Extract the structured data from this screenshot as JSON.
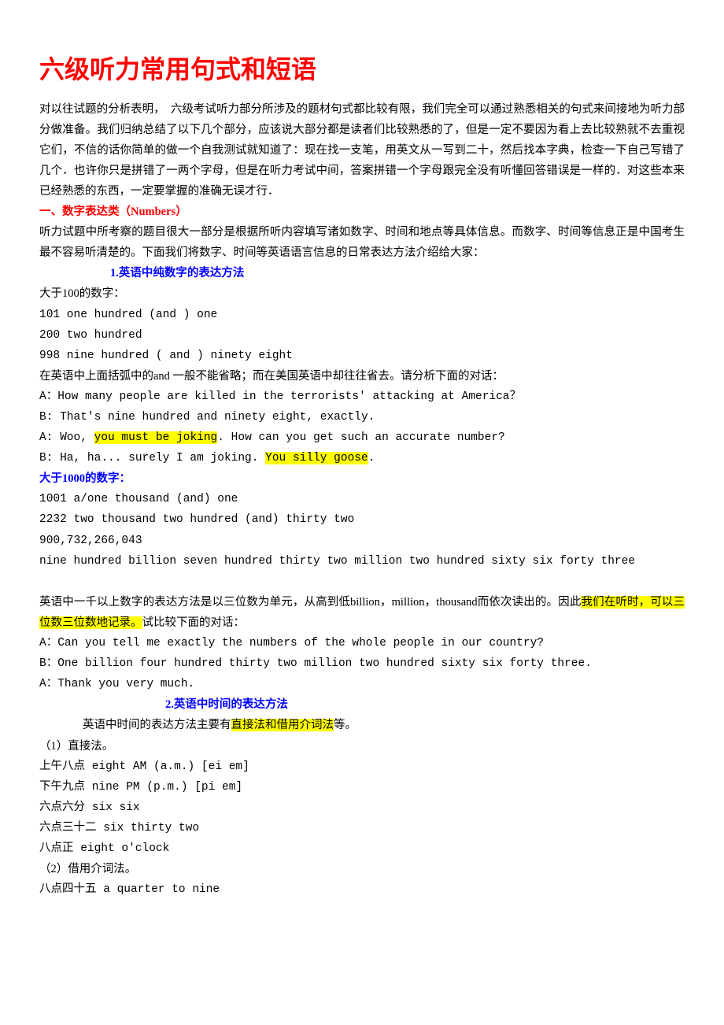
{
  "title": "六级听力常用句式和短语",
  "intro": "对以往试题的分析表明，　六级考试听力部分所涉及的题材句式都比较有限，我们完全可以通过熟悉相关的句式来间接地为听力部分做准备。我们归纳总结了以下几个部分，应该说大部分都是读者们比较熟悉的了，但是一定不要因为看上去比较熟就不去重视它们，不信的话你简单的做一个自我测试就知道了：现在找一支笔，用英文从一写到二十，然后找本字典，检查一下自己写错了几个．也许你只是拼错了一两个字母，但是在听力考试中间，答案拼错一个字母跟完全没有听懂回答错误是一样的．对这些本来已经熟悉的东西，一定要掌握的准确无误才行．",
  "sec1_heading": "一、数字表达类（Numbers）",
  "sec1_intro": "听力试题中所考察的题目很大一部分是根据所听内容填写诸如数字、时间和地点等具体信息。而数字、时间等信息正是中国考生最不容易听清楚的。下面我们将数字、时间等英语语言信息的日常表达方法介绍给大家：",
  "sub1_heading": "1.英语中纯数字的表达方法",
  "gt100_label": "大于100的数字：",
  "line_101": "101      one hundred (and ) one",
  "line_200": "200      two hundred",
  "line_998": "998      nine hundred ( and ) ninety  eight",
  "and_note": "在英语中上面括弧中的and 一般不能省略；而在美国英语中却往往省去。请分析下面的对话：",
  "dlg1_a1": "A：How many people are killed in the terrorists' attacking at America？",
  "dlg1_b1": "B:   That's nine hundred and ninety  eight, exactly.",
  "dlg1_a2_pre": "A:   Woo, ",
  "dlg1_a2_hl": "you must be joking",
  "dlg1_a2_post": ". How can you get such an accurate number?",
  "dlg1_b2_pre": "B:   Ha, ha...   surely I am joking. ",
  "dlg1_b2_hl": "You silly goose",
  "dlg1_b2_post": ".",
  "gt1000_heading": "大于1000的数字：",
  "line_1001": "1001      a/one thousand (and) one",
  "line_2232": "2232      two thousand two hundred (and) thirty  two",
  "big_num": "900,732,266,043",
  "big_num_words": "nine hundred billion seven hundred thirty  two million two hundred sixty  six forty three",
  "thousand_note_pre": "英语中一千以上数字的表达方法是以三位数为单元，从高到低billion，million，thousand而依次读出的。因此",
  "thousand_note_hl": "我们在听时，可以三位数三位数地记录。",
  "thousand_note_post": "试比较下面的对话：",
  "dlg2_a1": "A：Can you tell me exactly the numbers of the whole people in our country?",
  "dlg2_b1": "B：One billion four hundred thirty  two million two hundred sixty  six forty three.",
  "dlg2_a2": "A：Thank you very much.",
  "sub2_heading": "2.英语中时间的表达方法",
  "time_intro_pre": "英语中时间的表达方法主要有",
  "time_intro_hl": "直接法和借用介词法",
  "time_intro_post": "等。",
  "method1_label": "（1）直接法。",
  "t_8am": "上午八点     eight AM (a.m.)       [ei  em]",
  "t_9pm": "下午九点     nine PM (p.m.)        [pi    em]",
  "t_66": "六点六分     six six",
  "t_632": "六点三十二     six thirty two",
  "t_8oc": "八点正     eight o'clock",
  "method2_label": "（2）借用介词法。",
  "t_845": "八点四十五     a quarter to nine"
}
